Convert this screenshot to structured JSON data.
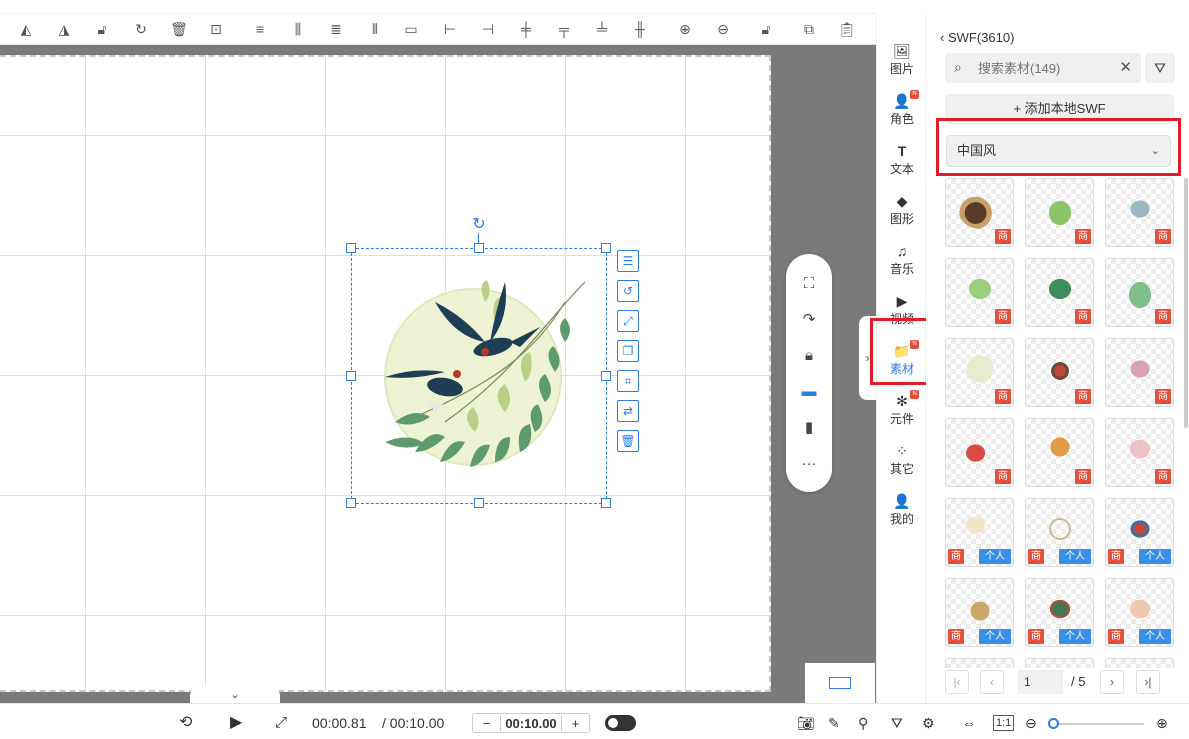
{
  "toolbar": {
    "icons": [
      "flip-horizontal-icon",
      "flip-vertical-icon",
      "unlock-icon",
      "rotate-icon",
      "delete-icon",
      "focus-icon",
      "align-top-icon",
      "align-middle-icon",
      "align-bottom-icon",
      "distribute-icon",
      "align-left-icon",
      "align-center-icon",
      "align-right-icon",
      "align-h-icon",
      "align-v-icon",
      "distribute-h-icon",
      "zoom-in-icon",
      "zoom-out-icon",
      "lock-icon",
      "copy-icon",
      "paste-icon"
    ]
  },
  "canvas": {
    "element_tools": [
      "align-icon",
      "rotate-icon",
      "fit-icon",
      "layer-icon",
      "crop-icon",
      "replace-icon",
      "delete-icon"
    ]
  },
  "float_bar": [
    "screenshot-icon",
    "rotate-icon",
    "lock-icon",
    "screen-icon",
    "mobile-icon",
    "more-icon"
  ],
  "playback": {
    "current_time": "00:00.81",
    "total_time": "/ 00:10.00",
    "duration_value": "00:10.00",
    "minus": "−",
    "plus": "+"
  },
  "category_nav": [
    {
      "label": "图片",
      "icon": "🖼",
      "badge": false
    },
    {
      "label": "角色",
      "icon": "👤",
      "badge": true
    },
    {
      "label": "文本",
      "icon": "T",
      "badge": false
    },
    {
      "label": "图形",
      "icon": "◆",
      "badge": false
    },
    {
      "label": "音乐",
      "icon": "♫",
      "badge": false
    },
    {
      "label": "视频",
      "icon": "▶",
      "badge": false
    },
    {
      "label": "素材",
      "icon": "📁",
      "badge": true
    },
    {
      "label": "元件",
      "icon": "✻",
      "badge": true
    },
    {
      "label": "其它",
      "icon": "⁘",
      "badge": false
    },
    {
      "label": "我的",
      "icon": "👤",
      "badge": false
    }
  ],
  "badge_text": "N",
  "panel": {
    "back_title": "SWF(3610)",
    "search_placeholder": "搜索素材(149)",
    "add_local": "+ 添加本地SWF",
    "dropdown_value": "中国风",
    "badge_shop": "商",
    "badge_personal": "个人",
    "tiles": [
      {
        "badges": "s"
      },
      {
        "badges": "s"
      },
      {
        "badges": "s"
      },
      {
        "badges": "s"
      },
      {
        "badges": "s"
      },
      {
        "badges": "s"
      },
      {
        "badges": "s"
      },
      {
        "badges": "s"
      },
      {
        "badges": "s"
      },
      {
        "badges": "s"
      },
      {
        "badges": "s"
      },
      {
        "badges": "s"
      },
      {
        "badges": "sp"
      },
      {
        "badges": "sp"
      },
      {
        "badges": "sp"
      },
      {
        "badges": "sp"
      },
      {
        "badges": "sp"
      },
      {
        "badges": "sp"
      }
    ],
    "pager": {
      "current": "1",
      "total": "/ 5"
    }
  },
  "colors": {
    "accent": "#2b7de9",
    "highlight": "#e01b2a",
    "shop_badge": "#e4513c",
    "personal_badge": "#3a8ee6"
  }
}
